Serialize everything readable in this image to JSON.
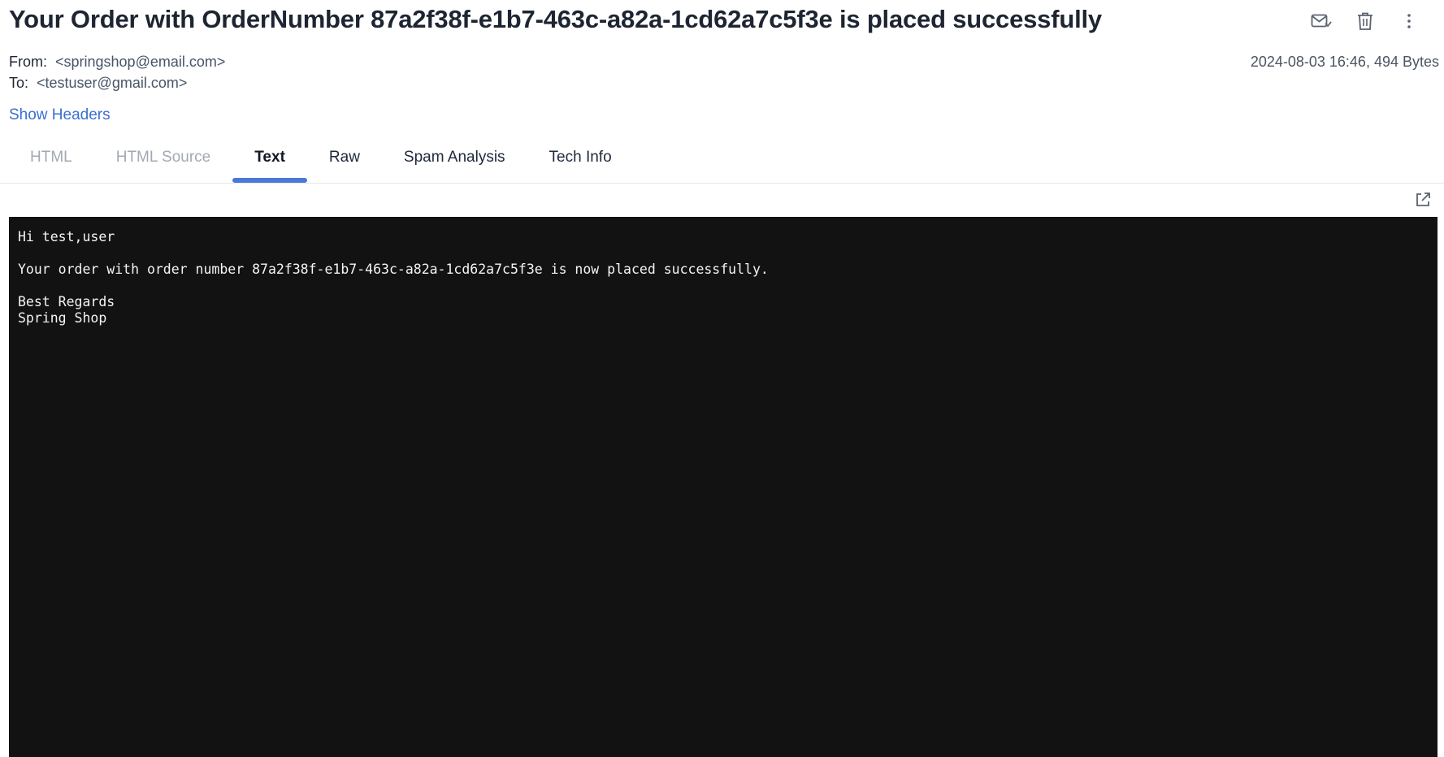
{
  "email": {
    "subject": "Your Order with OrderNumber 87a2f38f-e1b7-463c-a82a-1cd62a7c5f3e is placed successfully",
    "from_label": "From:",
    "from_value": "<springshop@email.com>",
    "to_label": "To:",
    "to_value": "<testuser@gmail.com>",
    "date_size": "2024-08-03 16:46, 494 Bytes",
    "show_headers": "Show Headers"
  },
  "toolbar": {
    "icons": [
      "mark-read-icon",
      "trash-icon",
      "more-vertical-icon"
    ]
  },
  "tabs": [
    {
      "label": "HTML",
      "state": "disabled"
    },
    {
      "label": "HTML Source",
      "state": "disabled"
    },
    {
      "label": "Text",
      "state": "active"
    },
    {
      "label": "Raw",
      "state": "normal"
    },
    {
      "label": "Spam Analysis",
      "state": "normal"
    },
    {
      "label": "Tech Info",
      "state": "normal"
    }
  ],
  "body": {
    "lines": [
      "Hi test,user",
      "",
      "Your order with order number 87a2f38f-e1b7-463c-a82a-1cd62a7c5f3e is now placed successfully.",
      "",
      "Best Regards",
      "Spring Shop"
    ]
  },
  "colors": {
    "accent": "#4a78d8",
    "link": "#3b6fd4",
    "panel_bg": "#121212"
  }
}
